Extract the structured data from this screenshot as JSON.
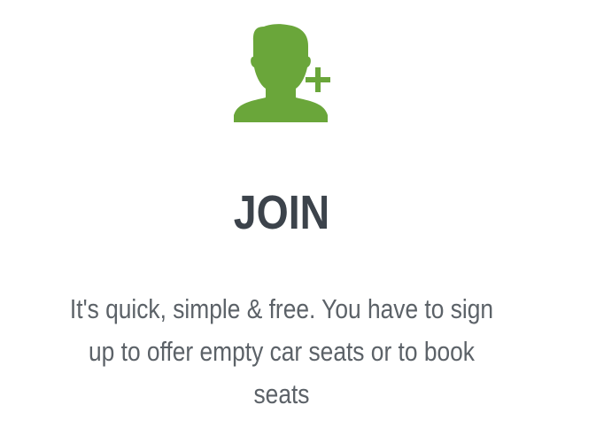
{
  "join_section": {
    "icon": "add-user-icon",
    "icon_color": "#6aa63a",
    "title": "JOIN",
    "title_color": "#3c434b",
    "description_lines": [
      "It's quick, simple & free. You have to sign",
      "up to offer empty car seats or to book",
      "seats"
    ],
    "text_color": "#5c6268"
  }
}
